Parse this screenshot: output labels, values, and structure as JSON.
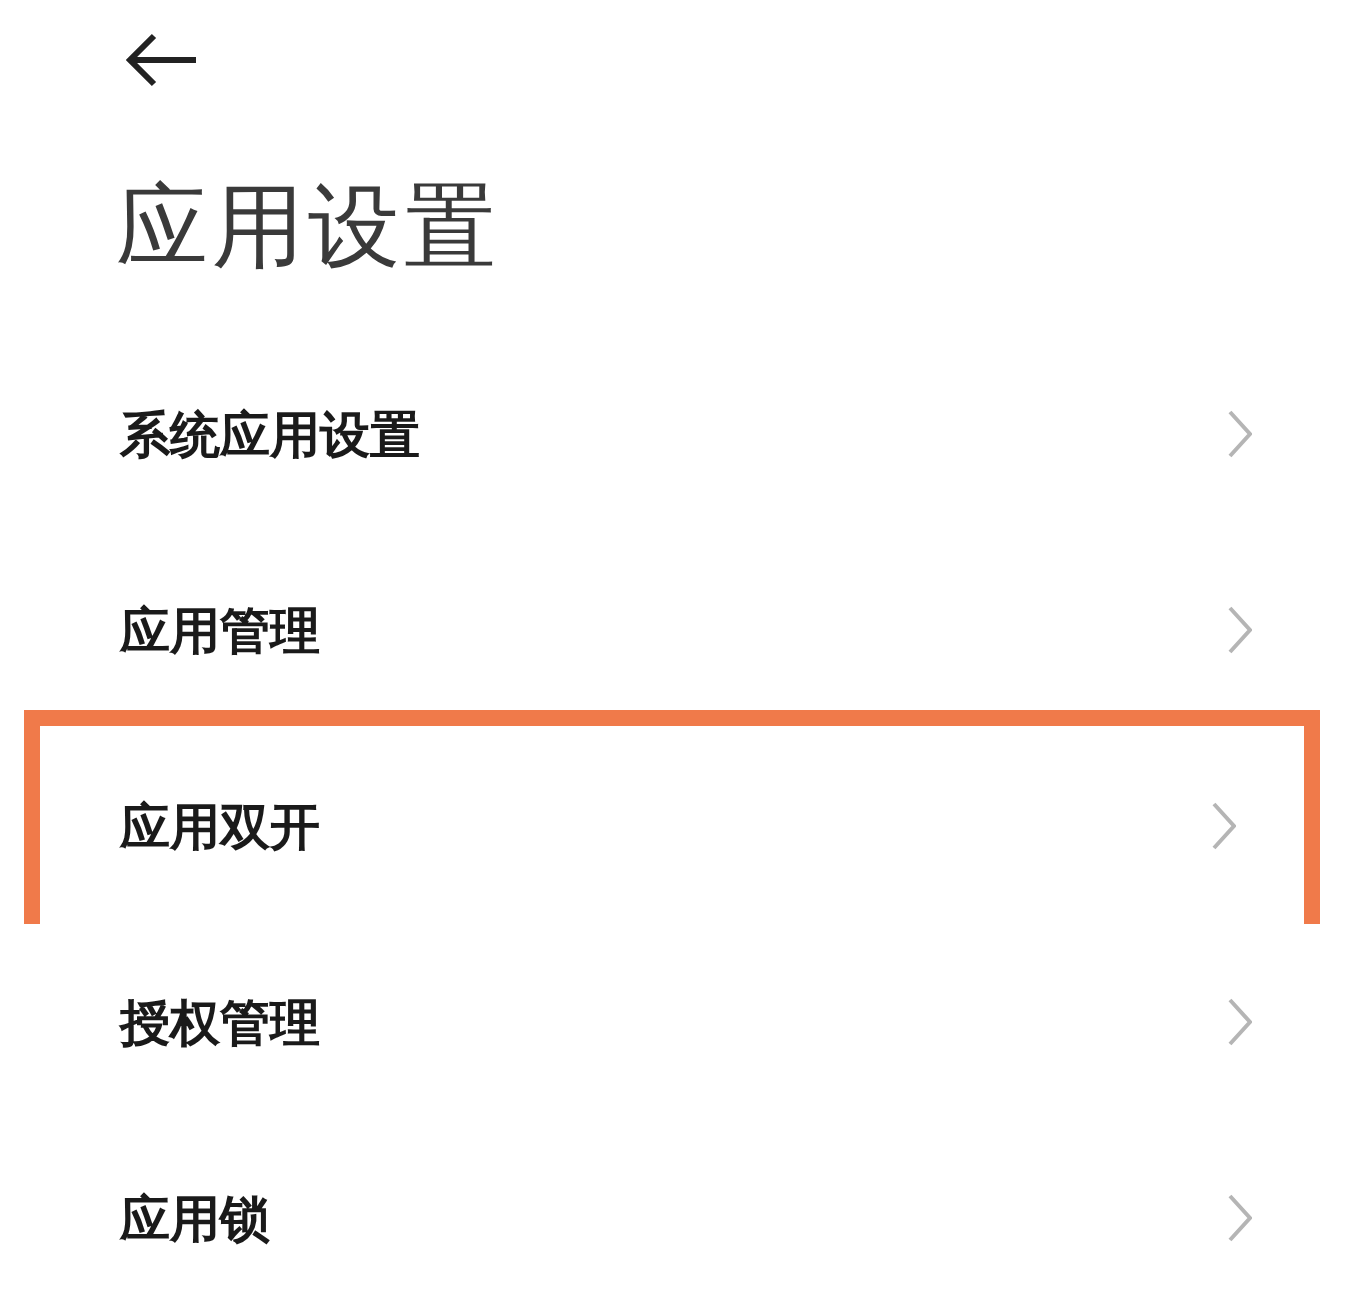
{
  "title": "应用设置",
  "items": [
    {
      "label": "系统应用设置",
      "highlighted": false
    },
    {
      "label": "应用管理",
      "highlighted": false
    },
    {
      "label": "应用双开",
      "highlighted": true
    },
    {
      "label": "授权管理",
      "highlighted": false
    },
    {
      "label": "应用锁",
      "highlighted": false
    }
  ]
}
